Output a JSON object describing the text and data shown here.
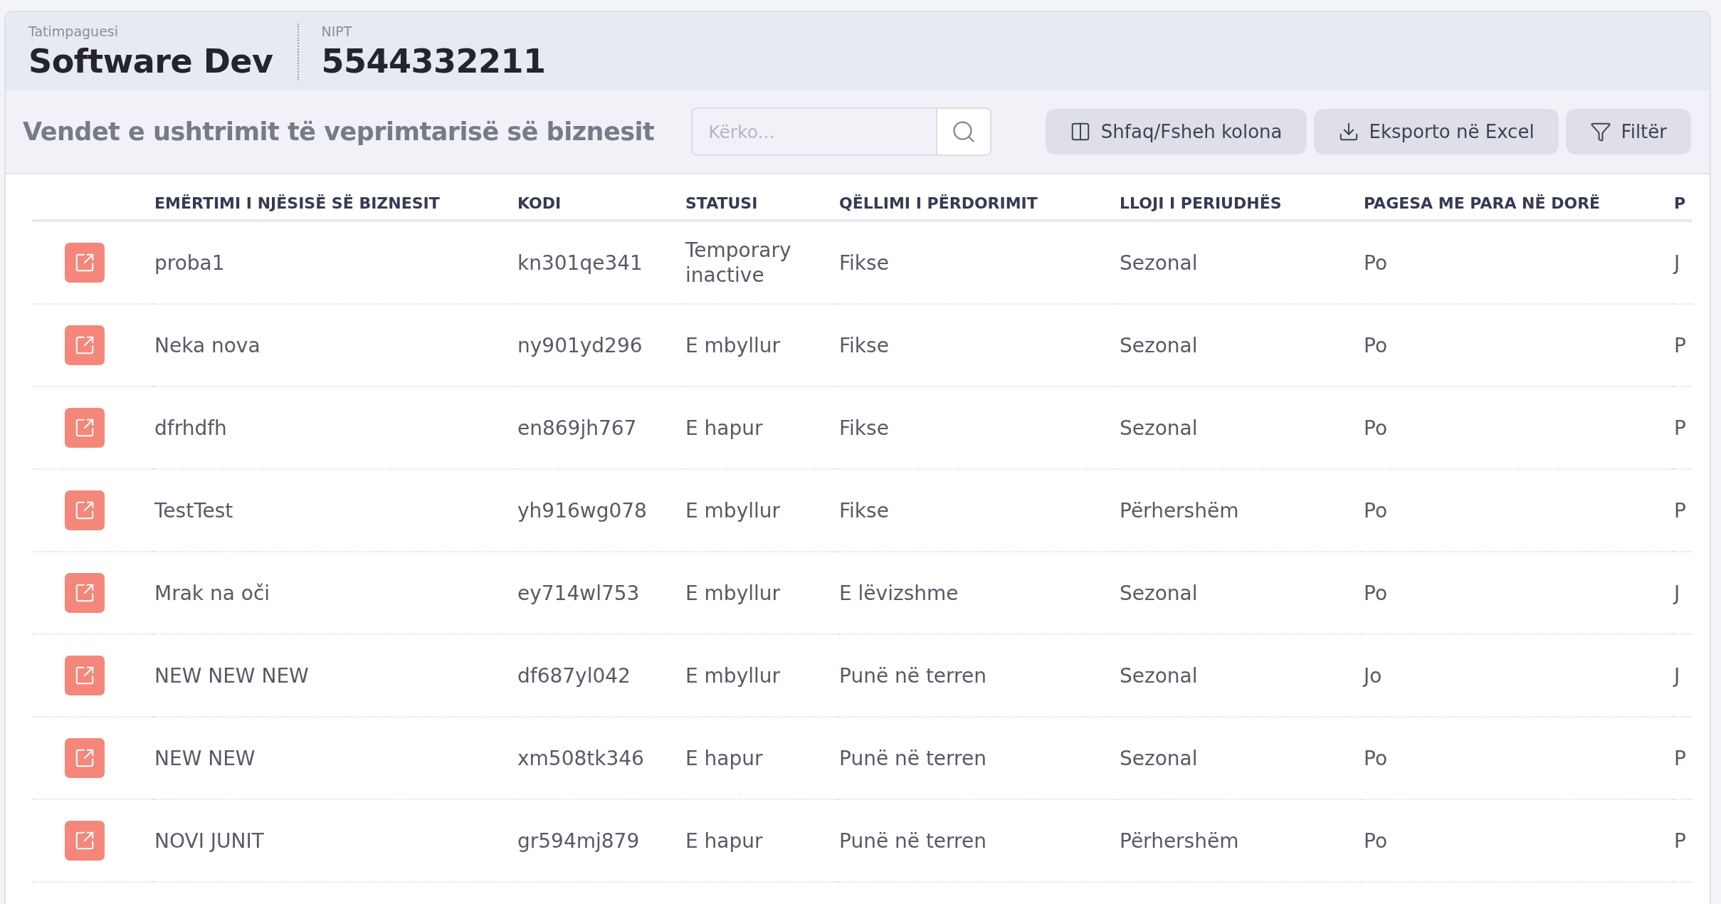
{
  "taxpayer": {
    "label": "Tatimpaguesi",
    "name": "Software Dev"
  },
  "nipt": {
    "label": "NIPT",
    "value": "5544332211"
  },
  "toolbar": {
    "title": "Vendet e ushtrimit të veprimtarisë së biznesit",
    "search": {
      "placeholder": "Kërko..."
    },
    "buttons": [
      {
        "kind": "columns",
        "label": "Shfaq/Fsheh kolona"
      },
      {
        "kind": "export",
        "label": "Eksporto në Excel"
      },
      {
        "kind": "filter",
        "label": "Filtër"
      }
    ]
  },
  "table": {
    "columns": [
      "EMËRTIMI I NJËSISË SË BIZNESIT",
      "KODI",
      "STATUSI",
      "QËLLIMI I PËRDORIMIT",
      "LLOJI I PERIUDHËS",
      "PAGESA ME PARA NË DORË",
      "P"
    ],
    "rows": [
      [
        "proba1",
        "kn301qe341",
        "Temporary inactive",
        "Fikse",
        "Sezonal",
        "Po",
        "J"
      ],
      [
        "Neka nova",
        "ny901yd296",
        "E mbyllur",
        "Fikse",
        "Sezonal",
        "Po",
        "P"
      ],
      [
        "dfrhdfh",
        "en869jh767",
        "E hapur",
        "Fikse",
        "Sezonal",
        "Po",
        "P"
      ],
      [
        "TestTest",
        "yh916wg078",
        "E mbyllur",
        "Fikse",
        "Përhershëm",
        "Po",
        "P"
      ],
      [
        "Mrak na oči",
        "ey714wl753",
        "E mbyllur",
        "E lëvizshme",
        "Sezonal",
        "Po",
        "J"
      ],
      [
        "NEW NEW NEW",
        "df687yl042",
        "E mbyllur",
        "Punë në terren",
        "Sezonal",
        "Jo",
        "J"
      ],
      [
        "NEW NEW",
        "xm508tk346",
        "E hapur",
        "Punë në terren",
        "Sezonal",
        "Po",
        "P"
      ],
      [
        "NOVI JUNIT",
        "gr594mj879",
        "E hapur",
        "Punë në terren",
        "Përhershëm",
        "Po",
        "P"
      ]
    ]
  }
}
